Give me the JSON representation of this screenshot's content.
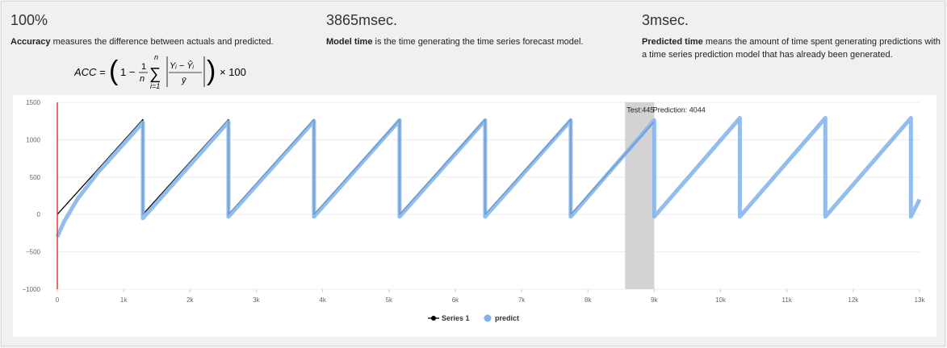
{
  "metrics": [
    {
      "value": "100%",
      "term": "Accuracy",
      "rest": " measures the difference between actuals and predicted."
    },
    {
      "value": "3865msec.",
      "term": "Model time",
      "rest": " is the time generating the time series forecast model."
    },
    {
      "value": "3msec.",
      "term": "Predicted time",
      "rest": " means the amount of time spent generating predictions with a time series prediction model that has already been generated."
    }
  ],
  "formula": {
    "lhs": "ACC =",
    "open": "(",
    "one_minus": "1 −",
    "frac_num": "1",
    "frac_den": "n",
    "sum_top": "n",
    "sum_sym": "∑",
    "sum_bottom": "i=1",
    "abs_num": "Yᵢ − Ŷᵢ",
    "abs_den": "ȳ",
    "close": ")",
    "times": "× 100"
  },
  "chart_data": {
    "type": "line",
    "xlim": [
      0,
      13000
    ],
    "ylim": [
      -1000,
      1500
    ],
    "x_ticks": [
      "0",
      "1k",
      "2k",
      "3k",
      "4k",
      "5k",
      "6k",
      "7k",
      "8k",
      "9k",
      "10k",
      "11k",
      "12k",
      "13k"
    ],
    "y_ticks": [
      "1500",
      "1000",
      "500",
      "0",
      "−500",
      "−1000"
    ],
    "grid": true,
    "legend_position": "bottom-center",
    "series": [
      {
        "name": "Series 1",
        "color": "#000000",
        "points": [
          [
            0,
            0
          ],
          [
            1290,
            1270
          ],
          [
            1290,
            0
          ],
          [
            2580,
            1270
          ],
          [
            2580,
            0
          ],
          [
            3870,
            1270
          ],
          [
            3870,
            0
          ],
          [
            5160,
            1270
          ],
          [
            5160,
            0
          ],
          [
            6450,
            1270
          ],
          [
            6450,
            0
          ],
          [
            7740,
            1270
          ],
          [
            7740,
            0
          ],
          [
            9000,
            1240
          ]
        ]
      },
      {
        "name": "predict",
        "color": "#7fb2ea",
        "points": [
          [
            0,
            -300
          ],
          [
            100,
            -100
          ],
          [
            300,
            200
          ],
          [
            600,
            550
          ],
          [
            1290,
            1230
          ],
          [
            1290,
            -50
          ],
          [
            2580,
            1240
          ],
          [
            2580,
            -30
          ],
          [
            3870,
            1250
          ],
          [
            3870,
            -30
          ],
          [
            5160,
            1260
          ],
          [
            5160,
            -30
          ],
          [
            6450,
            1260
          ],
          [
            6450,
            -30
          ],
          [
            7740,
            1260
          ],
          [
            7740,
            -30
          ],
          [
            9000,
            1260
          ],
          [
            9000,
            -30
          ],
          [
            10290,
            1290
          ],
          [
            10290,
            -30
          ],
          [
            11580,
            1290
          ],
          [
            11580,
            -30
          ],
          [
            12870,
            1290
          ],
          [
            12870,
            -30
          ],
          [
            13000,
            200
          ]
        ]
      }
    ],
    "highlight_band": {
      "x_start": 8560,
      "x_end": 9000,
      "color": "#d3d3d3"
    },
    "marker_line": {
      "x": 0,
      "color": "#e53935"
    },
    "annotations": [
      {
        "x": 8560,
        "y": 1400,
        "text": "Test:445"
      },
      {
        "x": 8980,
        "y": 1400,
        "text": "Prediction: 4044"
      }
    ]
  }
}
